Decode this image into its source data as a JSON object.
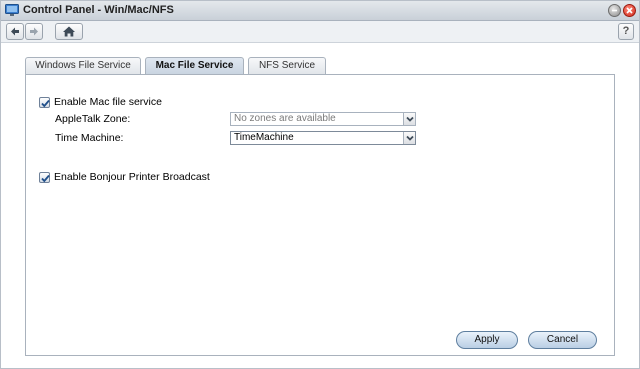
{
  "window": {
    "title": "Control Panel - Win/Mac/NFS",
    "app_icon": "monitor-icon",
    "controls": [
      "minimize-icon",
      "close-icon"
    ]
  },
  "toolbar": {
    "back_icon": "arrow-left-icon",
    "forward_icon": "arrow-right-icon",
    "home_icon": "home-icon",
    "help_label": "?"
  },
  "tabs": [
    {
      "label": "Windows File Service",
      "active": false
    },
    {
      "label": "Mac File Service",
      "active": true
    },
    {
      "label": "NFS Service",
      "active": false
    }
  ],
  "mac_service": {
    "enable": {
      "label": "Enable Mac file service",
      "checked": true
    },
    "appletalk": {
      "label": "AppleTalk Zone:",
      "value": "No zones are available",
      "disabled": true
    },
    "time_machine": {
      "label": "Time Machine:",
      "value": "TimeMachine",
      "disabled": false
    },
    "bonjour": {
      "label": "Enable Bonjour Printer Broadcast",
      "checked": true
    }
  },
  "buttons": {
    "apply": "Apply",
    "cancel": "Cancel"
  },
  "colors": {
    "active_tab": "#c8d3e0",
    "button_fill": "#b9cee4",
    "close_button": "#d0271a"
  }
}
